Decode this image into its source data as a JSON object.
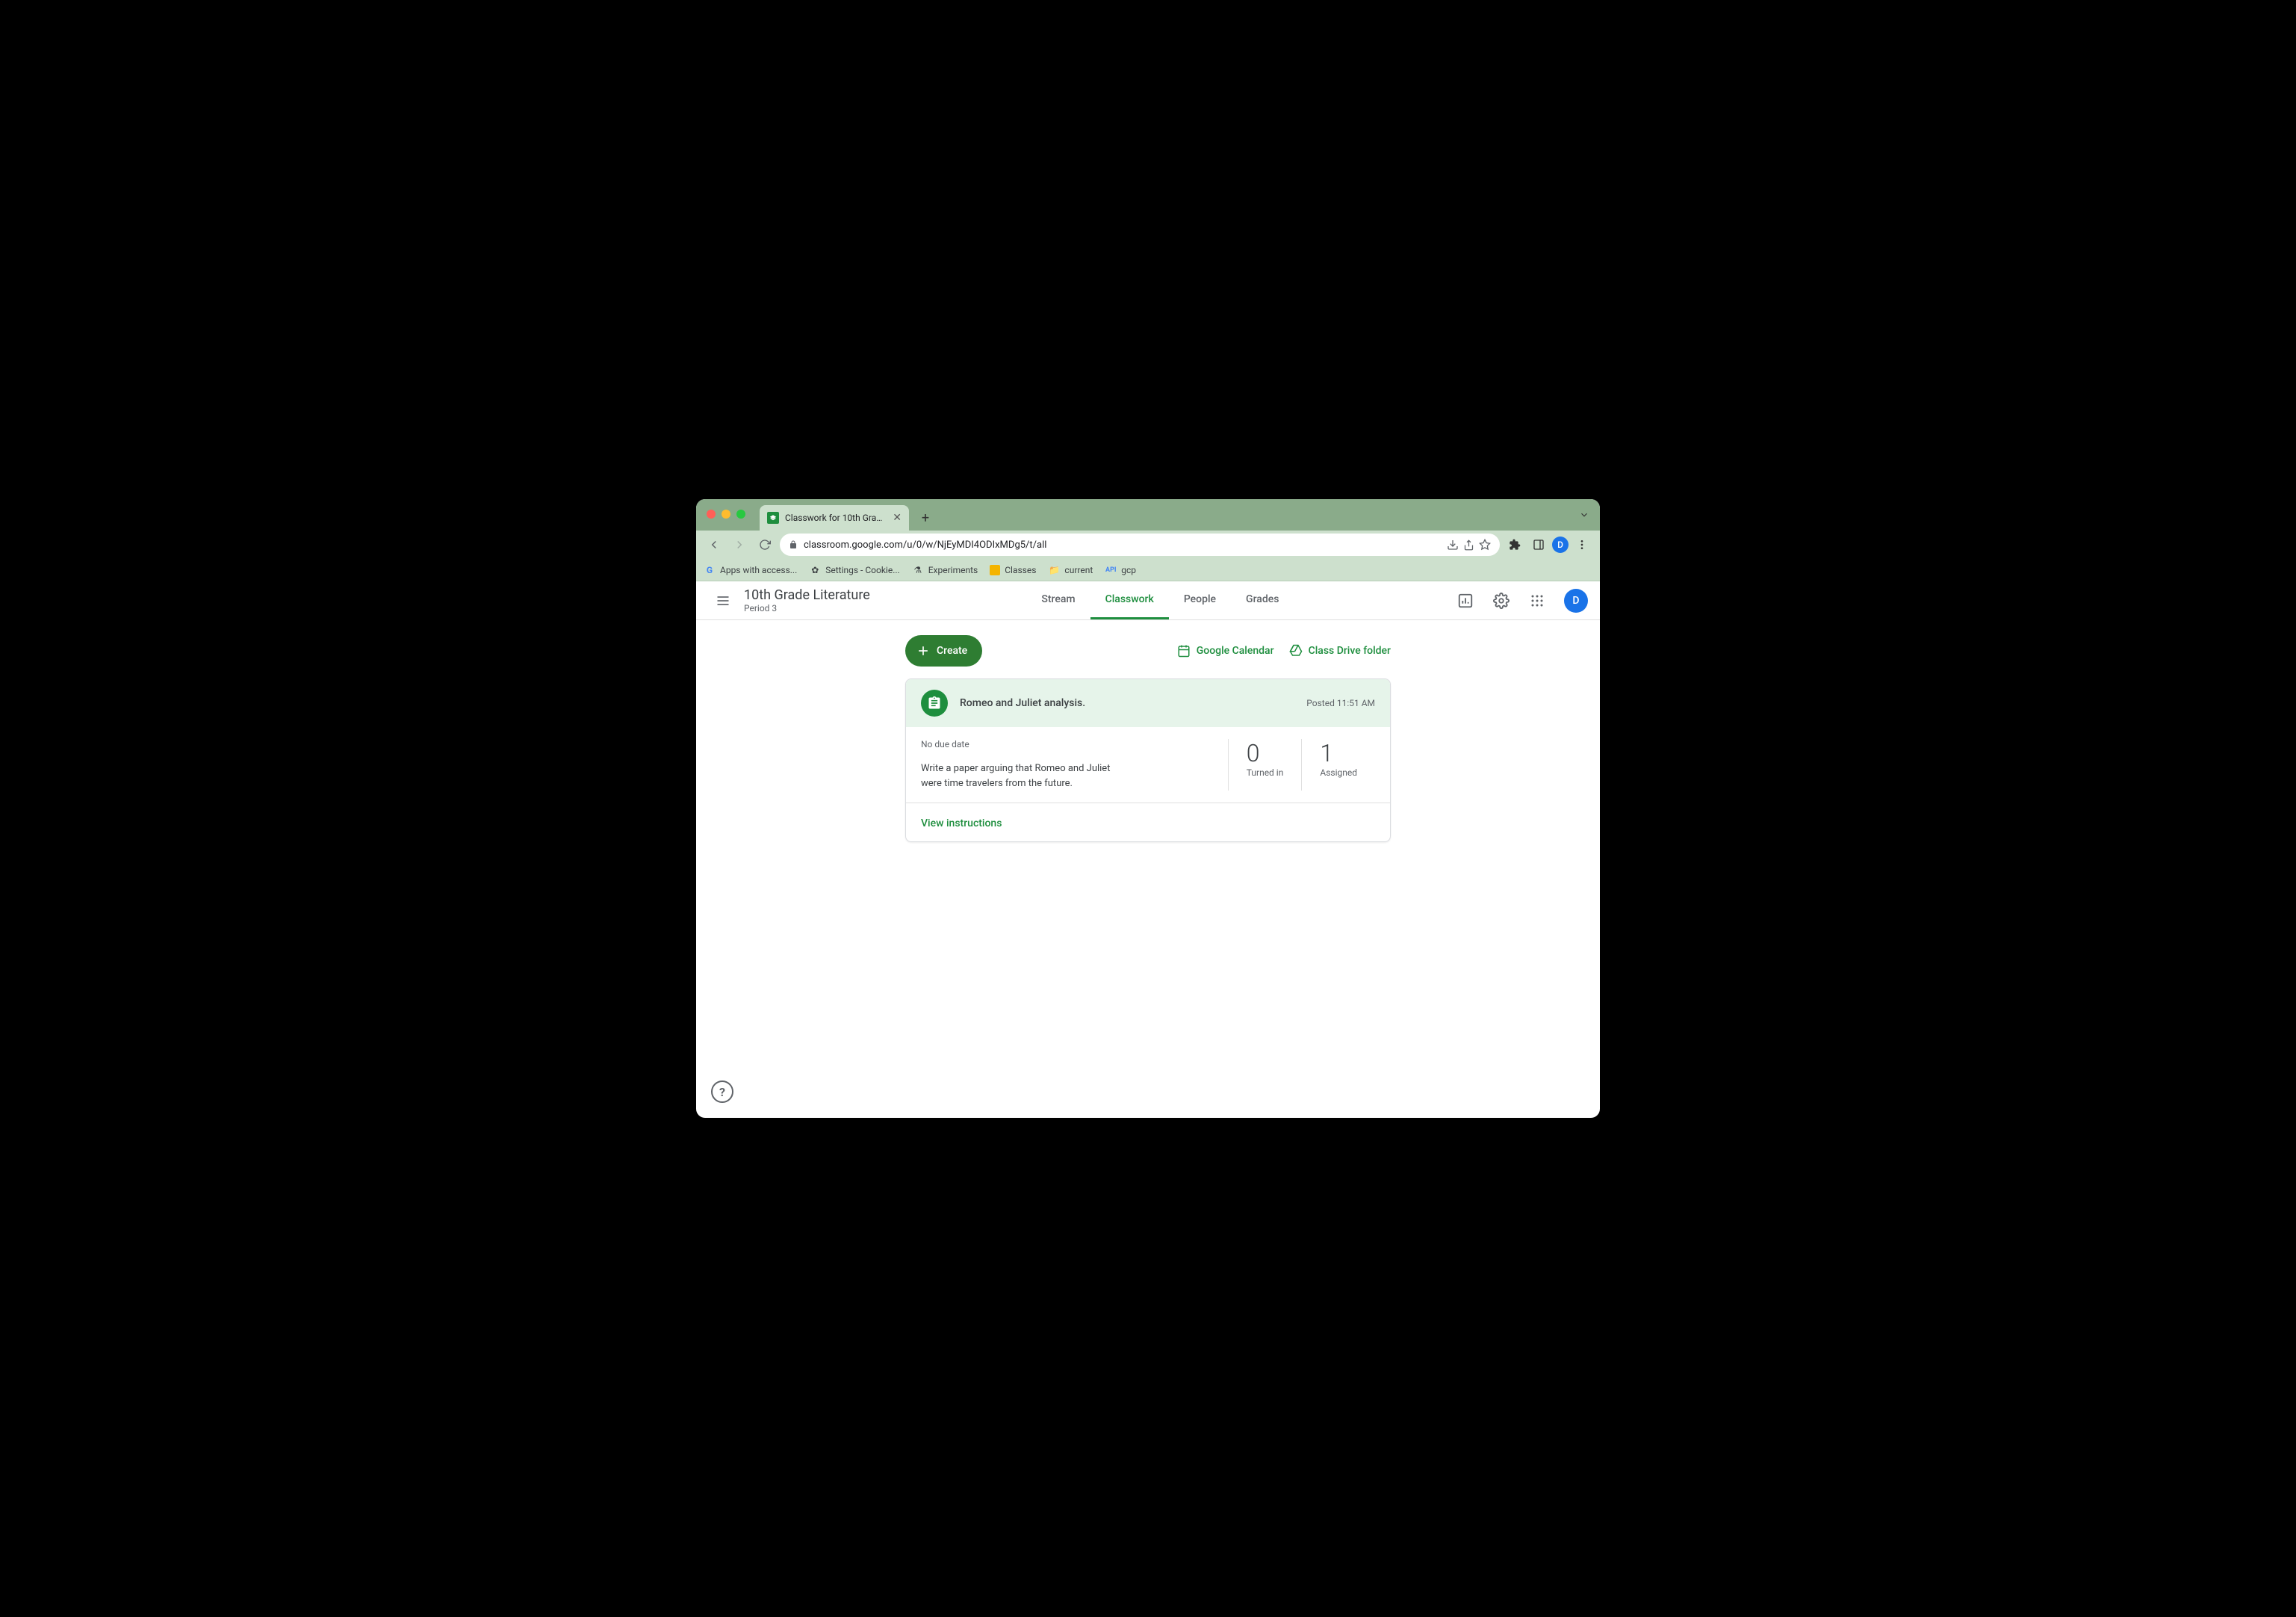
{
  "browser": {
    "tab_title": "Classwork for 10th Grade Litera",
    "url": "classroom.google.com/u/0/w/NjEyMDI4ODIxMDg5/t/all",
    "profile_initial": "D",
    "bookmarks": [
      {
        "label": "Apps with access..."
      },
      {
        "label": "Settings - Cookie..."
      },
      {
        "label": "Experiments"
      },
      {
        "label": "Classes"
      },
      {
        "label": "current"
      },
      {
        "label": "gcp"
      }
    ]
  },
  "header": {
    "class_title": "10th Grade Literature",
    "class_subtitle": "Period 3",
    "tabs": {
      "stream": "Stream",
      "classwork": "Classwork",
      "people": "People",
      "grades": "Grades"
    },
    "avatar_initial": "D"
  },
  "actions": {
    "create": "Create",
    "calendar": "Google Calendar",
    "drive": "Class Drive folder"
  },
  "assignment": {
    "title": "Romeo and Juliet analysis.",
    "posted": "Posted 11:51 AM",
    "due": "No due date",
    "description": "Write a paper arguing that Romeo and Juliet were time travelers from the future.",
    "turned_in_count": "0",
    "turned_in_label": "Turned in",
    "assigned_count": "1",
    "assigned_label": "Assigned",
    "view_link": "View instructions"
  }
}
